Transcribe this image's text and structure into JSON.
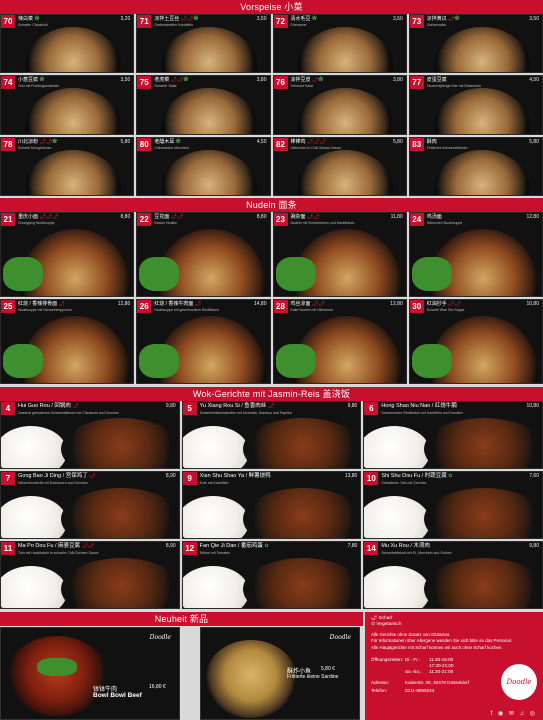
{
  "sections": {
    "vorspeise": "Vorspeise  小菜",
    "nudeln": "Nudeln  面条",
    "wok": "Wok-Gerichte mit Jasmin-Reis  盖浇饭",
    "neuheit": "Neuheit  新品"
  },
  "vorspeise": [
    {
      "num": "70",
      "name": "辣白菜",
      "sub": "Scharfer Chinakohl",
      "price": "3,20",
      "chili": "",
      "leaf": "✿"
    },
    {
      "num": "71",
      "name": "凉拌土豆丝",
      "sub": "Gurkenstreifen Kartoffeln",
      "price": "3,50",
      "chili": "🌶🌶",
      "leaf": "✿"
    },
    {
      "num": "72",
      "name": "清水毛豆",
      "sub": "Edamame",
      "price": "3,50",
      "chili": "",
      "leaf": "✿"
    },
    {
      "num": "73",
      "name": "凉拌黄瓜",
      "sub": "Gurkensalat",
      "price": "3,50",
      "chili": "🌶",
      "leaf": "✿"
    },
    {
      "num": "74",
      "name": "小葱豆腐",
      "sub": "Tofu mit Frühlingszwiebeln",
      "price": "3,50",
      "chili": "",
      "leaf": "✿"
    },
    {
      "num": "75",
      "name": "老虎菜",
      "sub": "Scharfer Salat",
      "price": "3,80",
      "chili": "🌶🌶",
      "leaf": "✿"
    },
    {
      "num": "76",
      "name": "凉拌豆皮",
      "name2": "",
      "sub": "Tofuhaut Salat",
      "price": "3,80",
      "chili": "🌶",
      "leaf": "✿"
    },
    {
      "num": "77",
      "name": "皮蛋豆腐",
      "sub": "Tausendjährige Eier mit Seidentofu",
      "price": "4,50",
      "chili": "",
      "leaf": ""
    },
    {
      "num": "78",
      "name": "川北凉粉",
      "sub": "Scharfe Mungbohnen",
      "price": "5,80",
      "chili": "🌶🌶",
      "leaf": "✿"
    },
    {
      "num": "80",
      "name": "老醋木耳",
      "sub": "Chinesische Morcheln",
      "price": "4,50",
      "chili": "",
      "leaf": "✿"
    },
    {
      "num": "82",
      "name": "棒棒鸡",
      "sub": "Hähnchen in Chili-Sesam-Sauce",
      "price": "5,80",
      "chili": "🌶🌶🌶",
      "leaf": ""
    },
    {
      "num": "83",
      "name": "酥肉",
      "sub": "Frittiertes Schweinefleisch",
      "price": "5,80",
      "chili": "",
      "leaf": ""
    }
  ],
  "nudeln": [
    {
      "num": "21",
      "name": "重庆小面",
      "sub": "Chongqing Nudelsuppe",
      "price": "8,80",
      "chili": "🌶🌶🌶",
      "leaf": ""
    },
    {
      "num": "22",
      "name": "豆花面",
      "sub": "Sesam Nudeln",
      "price": "8,80",
      "chili": "🌶🌶",
      "leaf": ""
    },
    {
      "num": "23",
      "name": "豌杂面",
      "sub": "Nudeln mit Kichererbsen und Hackfleisch",
      "price": "11,80",
      "chili": "🌶🌶",
      "leaf": ""
    },
    {
      "num": "24",
      "name": "鸡汤面",
      "sub": "Hähnchen Nudelsuppe",
      "price": "12,80",
      "chili": "",
      "leaf": ""
    },
    {
      "num": "25",
      "name": "红烧 / 香辣排骨面",
      "sub": "Nudelsuppe mit Schweinerippchen",
      "price": "12,80",
      "chili": "🌶",
      "leaf": ""
    },
    {
      "num": "26",
      "name": "红烧 / 香辣牛肉面",
      "sub": "Nudelsuppe mit geschmortem Rindfleisch",
      "price": "14,80",
      "chili": "🌶",
      "leaf": ""
    },
    {
      "num": "28",
      "name": "鸡丝凉面",
      "sub": "Kalte Nudeln mit Hähnchen",
      "price": "12,80",
      "chili": "🌶🌶",
      "leaf": ""
    },
    {
      "num": "30",
      "name": "红油抄手",
      "sub": "Scharfe Wan Tan Suppe",
      "price": "10,80",
      "chili": "🌶🌶",
      "leaf": ""
    }
  ],
  "wok": [
    {
      "num": "4",
      "name": "Hui Guo Rou / 回锅肉",
      "sub": "Zweimal gebratenes Schweinefleisch mit Chinakohl und Gemüse",
      "price": "9,80",
      "chili": "🌶",
      "leaf": ""
    },
    {
      "num": "5",
      "name": "Yu Xiang Rou Si / 鱼香肉丝",
      "sub": "Schweinefleischstreifen mit Morcheln, Bambus und Paprika",
      "price": "9,80",
      "chili": "🌶",
      "leaf": ""
    },
    {
      "num": "6",
      "name": "Hong Shao Niu Nan / 红烧牛腩",
      "sub": "Geschmortes Rindfleisch mit Kartoffeln und Karotten",
      "price": "10,80",
      "chili": "",
      "leaf": ""
    },
    {
      "num": "7",
      "name": "Gong Bao Ji Ding / 宫保鸡丁",
      "sub": "Hähnchenwürfel mit Erdnüssen und Gemüse",
      "price": "8,90",
      "chili": "🌶",
      "leaf": ""
    },
    {
      "num": "9",
      "name": "Xian Shu Shao Ya / 鲜薯烧鸭",
      "sub": "Ente mit Kartoffeln",
      "price": "13,80",
      "chili": "",
      "leaf": ""
    },
    {
      "num": "10",
      "name": "Shi Shu Dou Fu / 时蔬豆腐",
      "sub": "Gebratener Tofu mit Gemüse",
      "price": "7,60",
      "chili": "",
      "leaf": "✿"
    },
    {
      "num": "11",
      "name": "Ma Po Dou Fu / 麻婆豆腐",
      "sub": "Tofu mit Hackfleisch in scharfer Chili-Bohnen-Sauce",
      "price": "8,90",
      "chili": "🌶🌶",
      "leaf": ""
    },
    {
      "num": "12",
      "name": "Fan Qie Ji Dan / 番茄鸡蛋",
      "sub": "Rührei mit Tomaten",
      "price": "7,80",
      "chili": "",
      "leaf": "✿"
    },
    {
      "num": "14",
      "name": "Mu Xu Rou / 木须肉",
      "sub": "Schweinefleisch mit Ei, Morcheln und Gurken",
      "price": "9,80",
      "chili": "",
      "leaf": ""
    }
  ],
  "neuheit": [
    {
      "title": "Bowl Bowl Beef",
      "cn": "钵钵牛肉",
      "price": "16,80 €",
      "brand": "Doodle"
    },
    {
      "title": "Frittierte kleine Sardine",
      "cn": "酥炸小鱼",
      "price": "5,80 €",
      "brand": "Doodle"
    }
  ],
  "info": {
    "legend_spicy": "Scharf",
    "legend_veg": "Vegetarisch",
    "note1": "Alle Gerichte ohne Zusatz von Glutamat.",
    "note2": "Für Informationen über Allergene wenden Sie sich bitte an das Personal.",
    "note3": "Alle Hauptgerichte mit Scharf können wir auch ohne Scharf kochen.",
    "hours_label": "Öffnungszeiten:",
    "hours": [
      {
        "day": "Di - Fr.:",
        "time": "11:30-15:00"
      },
      {
        "day": "",
        "time": "17:30-21:00"
      },
      {
        "day": "Sa.-So.:",
        "time": "11:30-21:00"
      }
    ],
    "address_label": "Adresse:",
    "address": "Kaiserstr. 29, 40479 Düsseldorf",
    "phone_label": "Telefon:",
    "phone": "0211-9559243",
    "logo": "Doodle",
    "social": "f ◉ ✉ ♫ ◎"
  }
}
